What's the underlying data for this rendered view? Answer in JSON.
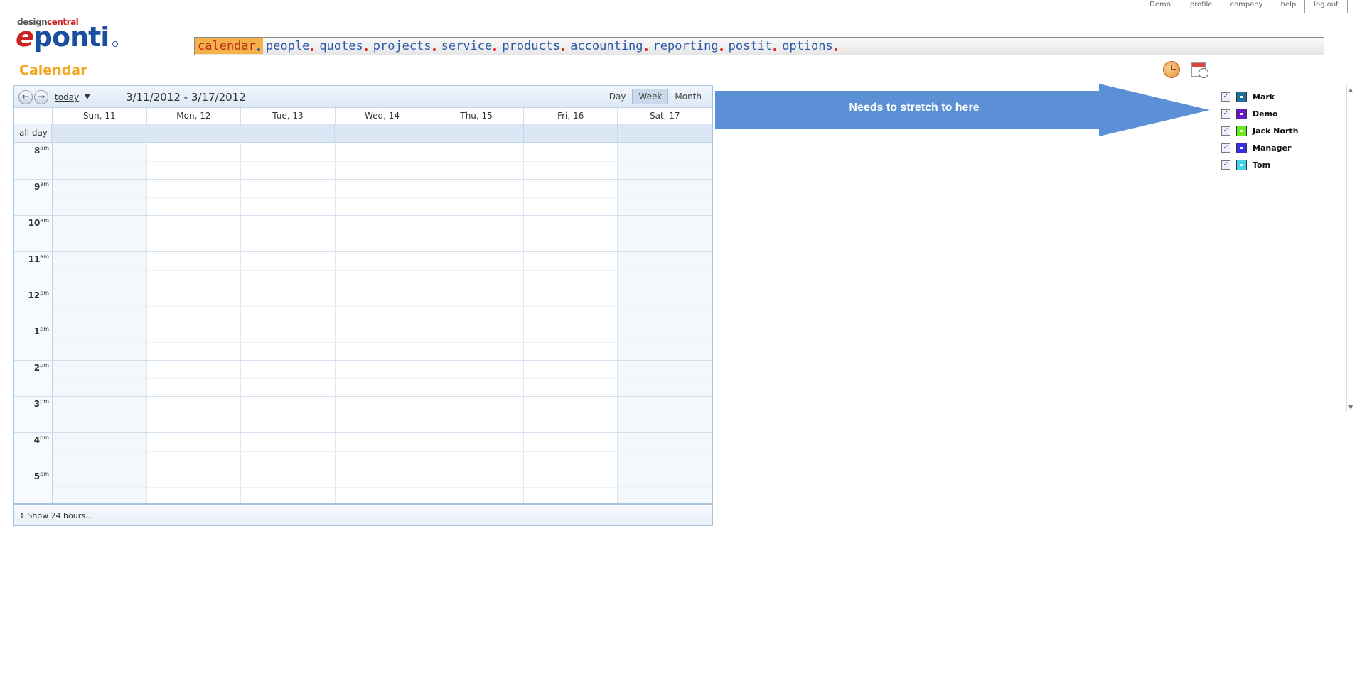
{
  "top_links": [
    "Demo",
    "profile",
    "company",
    "help",
    "log out"
  ],
  "logo": {
    "tagline_part1": "design",
    "tagline_part2": "central",
    "brand": "ponti",
    "brand_e": "e"
  },
  "nav": {
    "items": [
      "calendar",
      "people",
      "quotes",
      "projects",
      "service",
      "products",
      "accounting",
      "reporting",
      "postit",
      "options"
    ],
    "active": "calendar"
  },
  "page_title": "Calendar",
  "calendar": {
    "today_label": "today",
    "date_range": "3/11/2012 - 3/17/2012",
    "views": [
      "Day",
      "Week",
      "Month"
    ],
    "active_view": "Week",
    "days": [
      "Sun, 11",
      "Mon, 12",
      "Tue, 13",
      "Wed, 14",
      "Thu, 15",
      "Fri, 16",
      "Sat, 17"
    ],
    "allday_label": "all day",
    "hours": [
      {
        "h": "8",
        "ap": "am"
      },
      {
        "h": "9",
        "ap": "am"
      },
      {
        "h": "10",
        "ap": "am"
      },
      {
        "h": "11",
        "ap": "am"
      },
      {
        "h": "12",
        "ap": "pm"
      },
      {
        "h": "1",
        "ap": "pm"
      },
      {
        "h": "2",
        "ap": "pm"
      },
      {
        "h": "3",
        "ap": "pm"
      },
      {
        "h": "4",
        "ap": "pm"
      },
      {
        "h": "5",
        "ap": "pm"
      }
    ],
    "show_all_label": "Show 24 hours..."
  },
  "annotation": {
    "text": "Needs to stretch to here",
    "color": "#5b8fd6"
  },
  "users": [
    {
      "name": "Mark",
      "color": "#1f6f9a",
      "checked": true
    },
    {
      "name": "Demo",
      "color": "#6a16c8",
      "checked": true
    },
    {
      "name": "Jack North",
      "color": "#66ee22",
      "checked": true
    },
    {
      "name": "Manager",
      "color": "#3a2ee8",
      "checked": true
    },
    {
      "name": "Tom",
      "color": "#3ed4f0",
      "checked": true
    }
  ],
  "icons": {
    "clock": "clock-icon",
    "calendar_clock": "calendar-clock-icon"
  }
}
